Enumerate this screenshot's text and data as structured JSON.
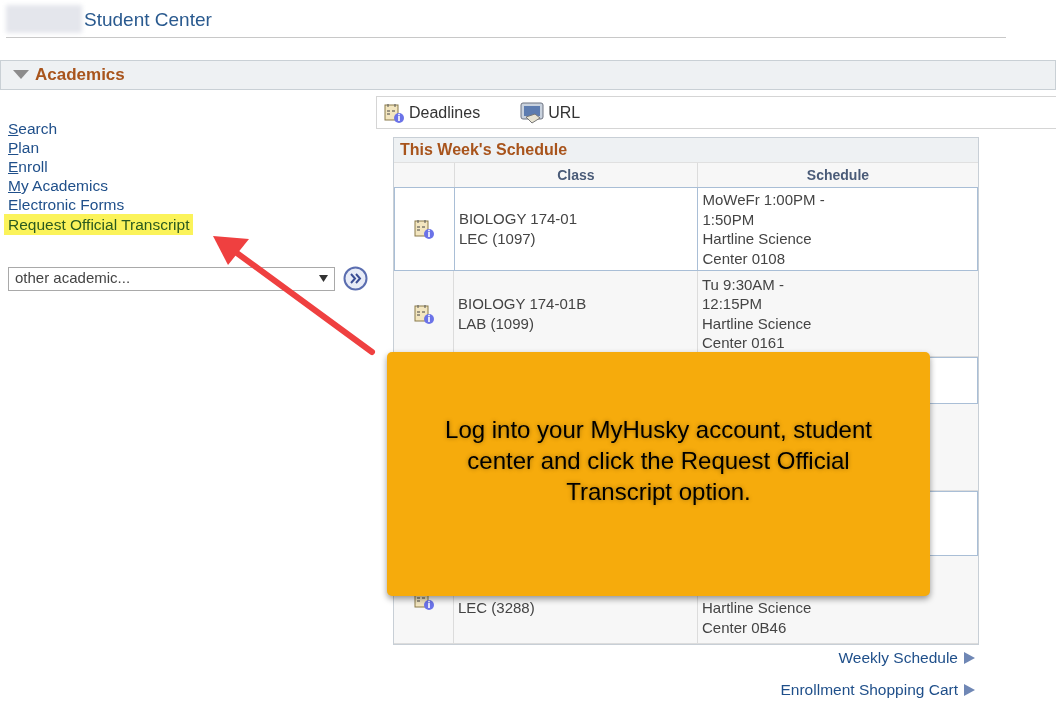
{
  "header": {
    "title": "Student Center",
    "redacted": true
  },
  "section": {
    "title": "Academics",
    "expanded": true
  },
  "links": [
    {
      "label": "Search",
      "underline_first": true,
      "highlighted": false
    },
    {
      "label": "Plan",
      "underline_first": true,
      "highlighted": false
    },
    {
      "label": "Enroll",
      "underline_first": true,
      "highlighted": false
    },
    {
      "label": "My Academics",
      "underline_first": true,
      "highlighted": false
    },
    {
      "label": "Electronic Forms",
      "underline_first": false,
      "highlighted": false
    },
    {
      "label": "Request Official Transcript",
      "underline_first": false,
      "highlighted": true
    }
  ],
  "dropdown": {
    "value": "other academic..."
  },
  "toolbar": [
    {
      "kind": "deadlines",
      "label": "Deadlines"
    },
    {
      "kind": "url",
      "label": "URL"
    }
  ],
  "schedule": {
    "title": "This Week's Schedule",
    "columns": [
      "Class",
      "Schedule"
    ],
    "rows": [
      {
        "class_lines": [
          "BIOLOGY 174-01",
          "LEC (1097)"
        ],
        "schedule_lines": [
          "MoWeFr 1:00PM -",
          "1:50PM",
          "Hartline Science",
          "Center 0108"
        ]
      },
      {
        "class_lines": [
          "BIOLOGY 174-01B",
          "LAB (1099)"
        ],
        "schedule_lines": [
          "Tu 9:30AM -",
          "12:15PM",
          "Hartline Science",
          "Center 0161"
        ]
      },
      {
        "class_lines": [],
        "schedule_lines": []
      },
      {
        "class_lines": [],
        "schedule_lines": []
      },
      {
        "class_lines": [],
        "schedule_lines": []
      },
      {
        "class_lines": [
          "LEC (3288)"
        ],
        "schedule_lines": [
          "Hartline Science",
          "Center 0B46"
        ]
      }
    ]
  },
  "footer_links": [
    "Weekly Schedule",
    "Enrollment Shopping Cart"
  ],
  "callout": {
    "text": "Log into your MyHusky account, student center and click the Request Official Transcript option."
  }
}
